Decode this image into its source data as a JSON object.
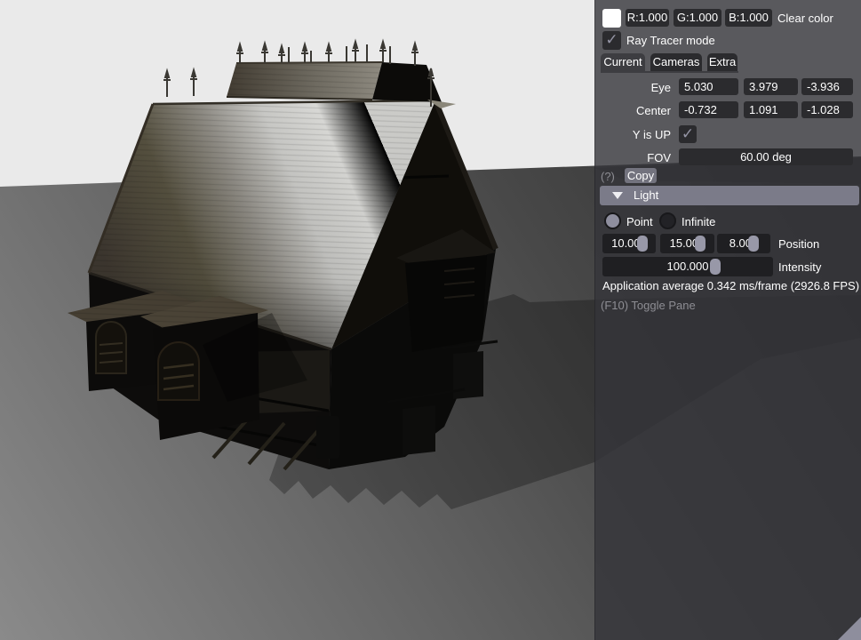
{
  "panel": {
    "clear_color": {
      "swatch_color": "#ffffff",
      "r_label": "R:1.000",
      "g_label": "G:1.000",
      "b_label": "B:1.000",
      "label": "Clear color"
    },
    "ray_tracer": {
      "label": "Ray Tracer mode",
      "checked": true,
      "check_glyph": "✓"
    },
    "tabs": [
      {
        "label": "Current",
        "active": true
      },
      {
        "label": "Cameras",
        "active": false
      },
      {
        "label": "Extra",
        "active": false
      }
    ],
    "camera": {
      "eye": {
        "label": "Eye",
        "x": "5.030",
        "y": "3.979",
        "z": "-3.936"
      },
      "center": {
        "label": "Center",
        "x": "-0.732",
        "y": "1.091",
        "z": "-1.028"
      },
      "y_is_up": {
        "label": "Y is UP",
        "checked": true,
        "check_glyph": "✓"
      },
      "fov": {
        "label": "FOV",
        "value": "60.00 deg"
      }
    },
    "help_label": "(?)",
    "copy_label": "Copy",
    "light": {
      "header": "Light",
      "point_label": "Point",
      "infinite_label": "Infinite",
      "selected": "Point",
      "position": {
        "x": "10.000",
        "y": "15.000",
        "z": "8.000",
        "label": "Position"
      },
      "intensity": {
        "value": "100.000",
        "label": "Intensity"
      }
    },
    "stats": "Application average 0.342 ms/frame (2926.8 FPS)",
    "toggle_hint": "(F10) Toggle Pane",
    "colors": {
      "panel_bg": "rgba(52,52,58,0.80)",
      "widget_bg": "#2b2b2e",
      "widget_bg_dark": "#1f1f22",
      "accent": "#8e8e9e",
      "header_bg": "#7b7b89",
      "button_bg": "#73737e",
      "text": "#ffffff",
      "text_dim": "#8d8d93"
    }
  },
  "viewport": {
    "sky_color": "#eaeaea",
    "ground_light": "#868686",
    "ground_dark": "#343434"
  }
}
